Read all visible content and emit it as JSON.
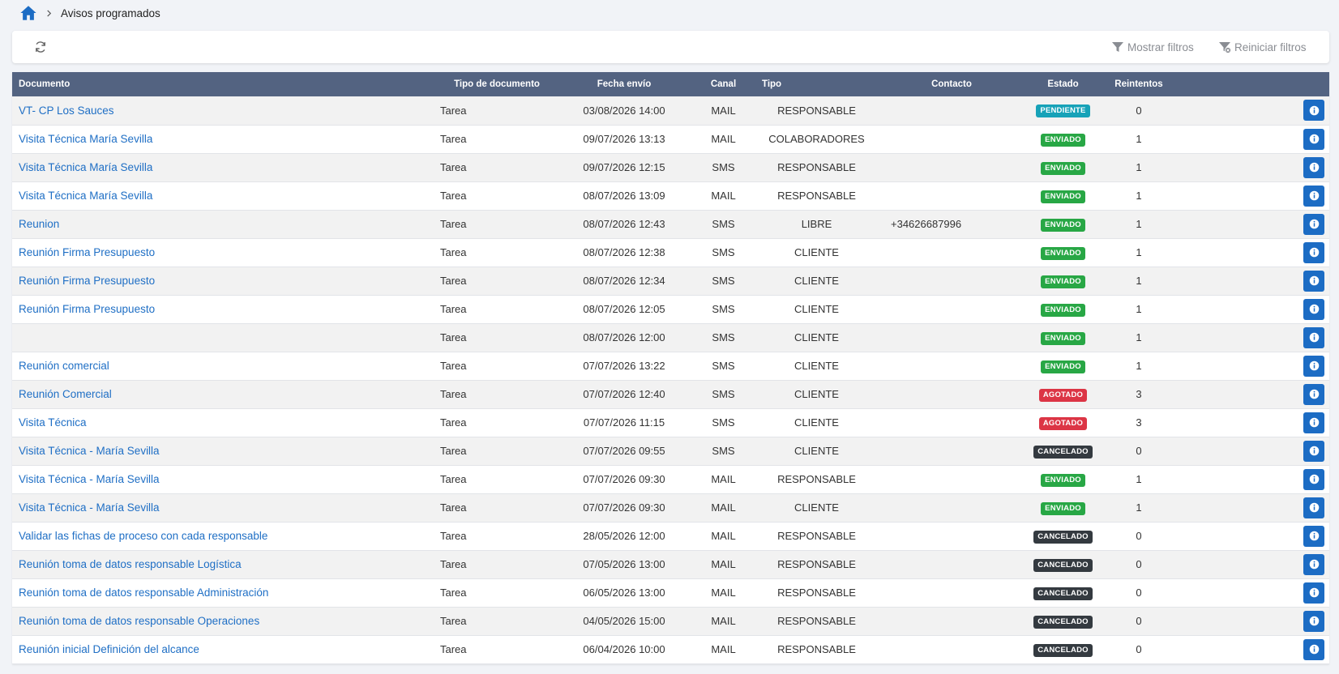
{
  "breadcrumb": {
    "home_icon": "home-icon",
    "current": "Avisos programados"
  },
  "toolbar": {
    "refresh_icon": "refresh-icon",
    "show_filters": "Mostrar filtros",
    "reset_filters": "Reiniciar filtros"
  },
  "table": {
    "headers": {
      "documento": "Documento",
      "tipo_documento": "Tipo de documento",
      "fecha_envio": "Fecha envío",
      "canal": "Canal",
      "tipo": "Tipo",
      "contacto": "Contacto",
      "estado": "Estado",
      "reintentos": "Reintentos"
    },
    "status_colors": {
      "PENDIENTE": "#17a2b8",
      "ENVIADO": "#28a745",
      "AGOTADO": "#dc3545",
      "CANCELADO": "#343a40"
    },
    "rows": [
      {
        "documento": "VT- CP Los Sauces",
        "tipo_documento": "Tarea",
        "fecha": "03/08/2026 14:00",
        "canal": "MAIL",
        "tipo": "RESPONSABLE",
        "contacto": "",
        "estado": "PENDIENTE",
        "reintentos": "0"
      },
      {
        "documento": "Visita Técnica María Sevilla",
        "tipo_documento": "Tarea",
        "fecha": "09/07/2026 13:13",
        "canal": "MAIL",
        "tipo": "COLABORADORES",
        "contacto": "",
        "estado": "ENVIADO",
        "reintentos": "1"
      },
      {
        "documento": "Visita Técnica María Sevilla",
        "tipo_documento": "Tarea",
        "fecha": "09/07/2026 12:15",
        "canal": "SMS",
        "tipo": "RESPONSABLE",
        "contacto": "",
        "estado": "ENVIADO",
        "reintentos": "1"
      },
      {
        "documento": "Visita Técnica María Sevilla",
        "tipo_documento": "Tarea",
        "fecha": "08/07/2026 13:09",
        "canal": "MAIL",
        "tipo": "RESPONSABLE",
        "contacto": "",
        "estado": "ENVIADO",
        "reintentos": "1"
      },
      {
        "documento": "Reunion",
        "tipo_documento": "Tarea",
        "fecha": "08/07/2026 12:43",
        "canal": "SMS",
        "tipo": "LIBRE",
        "contacto": "+34626687996",
        "estado": "ENVIADO",
        "reintentos": "1"
      },
      {
        "documento": "Reunión Firma Presupuesto",
        "tipo_documento": "Tarea",
        "fecha": "08/07/2026 12:38",
        "canal": "SMS",
        "tipo": "CLIENTE",
        "contacto": "",
        "estado": "ENVIADO",
        "reintentos": "1"
      },
      {
        "documento": "Reunión Firma Presupuesto",
        "tipo_documento": "Tarea",
        "fecha": "08/07/2026 12:34",
        "canal": "SMS",
        "tipo": "CLIENTE",
        "contacto": "",
        "estado": "ENVIADO",
        "reintentos": "1"
      },
      {
        "documento": "Reunión Firma Presupuesto",
        "tipo_documento": "Tarea",
        "fecha": "08/07/2026 12:05",
        "canal": "SMS",
        "tipo": "CLIENTE",
        "contacto": "",
        "estado": "ENVIADO",
        "reintentos": "1"
      },
      {
        "documento": "",
        "tipo_documento": "Tarea",
        "fecha": "08/07/2026 12:00",
        "canal": "SMS",
        "tipo": "CLIENTE",
        "contacto": "",
        "estado": "ENVIADO",
        "reintentos": "1"
      },
      {
        "documento": "Reunión comercial",
        "tipo_documento": "Tarea",
        "fecha": "07/07/2026 13:22",
        "canal": "SMS",
        "tipo": "CLIENTE",
        "contacto": "",
        "estado": "ENVIADO",
        "reintentos": "1"
      },
      {
        "documento": "Reunión Comercial",
        "tipo_documento": "Tarea",
        "fecha": "07/07/2026 12:40",
        "canal": "SMS",
        "tipo": "CLIENTE",
        "contacto": "",
        "estado": "AGOTADO",
        "reintentos": "3"
      },
      {
        "documento": "Visita Técnica",
        "tipo_documento": "Tarea",
        "fecha": "07/07/2026 11:15",
        "canal": "SMS",
        "tipo": "CLIENTE",
        "contacto": "",
        "estado": "AGOTADO",
        "reintentos": "3"
      },
      {
        "documento": "Visita Técnica - María Sevilla",
        "tipo_documento": "Tarea",
        "fecha": "07/07/2026 09:55",
        "canal": "SMS",
        "tipo": "CLIENTE",
        "contacto": "",
        "estado": "CANCELADO",
        "reintentos": "0"
      },
      {
        "documento": "Visita Técnica - María Sevilla",
        "tipo_documento": "Tarea",
        "fecha": "07/07/2026 09:30",
        "canal": "MAIL",
        "tipo": "RESPONSABLE",
        "contacto": "",
        "estado": "ENVIADO",
        "reintentos": "1"
      },
      {
        "documento": "Visita Técnica - María Sevilla",
        "tipo_documento": "Tarea",
        "fecha": "07/07/2026 09:30",
        "canal": "MAIL",
        "tipo": "CLIENTE",
        "contacto": "",
        "estado": "ENVIADO",
        "reintentos": "1"
      },
      {
        "documento": "Validar las fichas de proceso con cada responsable",
        "tipo_documento": "Tarea",
        "fecha": "28/05/2026 12:00",
        "canal": "MAIL",
        "tipo": "RESPONSABLE",
        "contacto": "",
        "estado": "CANCELADO",
        "reintentos": "0"
      },
      {
        "documento": "Reunión toma de datos responsable Logística",
        "tipo_documento": "Tarea",
        "fecha": "07/05/2026 13:00",
        "canal": "MAIL",
        "tipo": "RESPONSABLE",
        "contacto": "",
        "estado": "CANCELADO",
        "reintentos": "0"
      },
      {
        "documento": "Reunión toma de datos responsable Administración",
        "tipo_documento": "Tarea",
        "fecha": "06/05/2026 13:00",
        "canal": "MAIL",
        "tipo": "RESPONSABLE",
        "contacto": "",
        "estado": "CANCELADO",
        "reintentos": "0"
      },
      {
        "documento": "Reunión toma de datos responsable Operaciones",
        "tipo_documento": "Tarea",
        "fecha": "04/05/2026 15:00",
        "canal": "MAIL",
        "tipo": "RESPONSABLE",
        "contacto": "",
        "estado": "CANCELADO",
        "reintentos": "0"
      },
      {
        "documento": "Reunión inicial Definición del alcance",
        "tipo_documento": "Tarea",
        "fecha": "06/04/2026 10:00",
        "canal": "MAIL",
        "tipo": "RESPONSABLE",
        "contacto": "",
        "estado": "CANCELADO",
        "reintentos": "0"
      }
    ]
  }
}
